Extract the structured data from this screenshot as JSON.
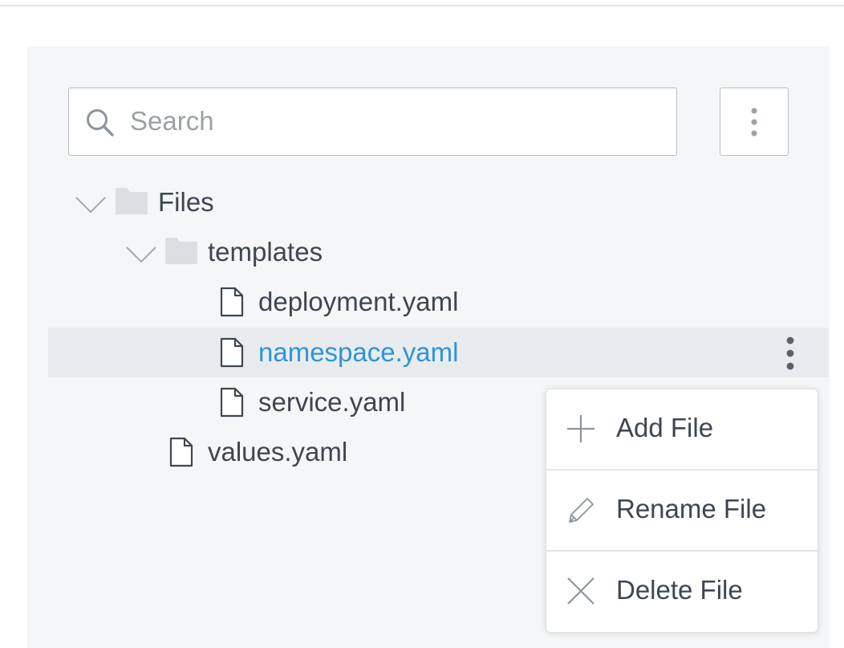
{
  "search": {
    "placeholder": "Search",
    "value": ""
  },
  "toolbar": {
    "more_icon": "vertical-ellipsis-icon"
  },
  "tree": {
    "root": {
      "label": "Files",
      "expanded": true,
      "icon": "folder-icon"
    },
    "templates": {
      "label": "templates",
      "expanded": true,
      "icon": "folder-icon"
    },
    "files": [
      {
        "label": "deployment.yaml",
        "icon": "file-icon"
      },
      {
        "label": "namespace.yaml",
        "icon": "file-icon",
        "selected": true
      },
      {
        "label": "service.yaml",
        "icon": "file-icon"
      }
    ],
    "root_files": [
      {
        "label": "values.yaml",
        "icon": "file-icon"
      }
    ]
  },
  "context_menu": {
    "items": [
      {
        "label": "Add File",
        "icon": "plus-icon"
      },
      {
        "label": "Rename File",
        "icon": "pencil-icon"
      },
      {
        "label": "Delete File",
        "icon": "close-icon"
      }
    ]
  },
  "colors": {
    "selected_text": "#2e93db",
    "selected_row_bg": "#e9ecef",
    "panel_bg": "#f4f6f8",
    "text": "#3f4650",
    "folder": "#dcdee1"
  }
}
